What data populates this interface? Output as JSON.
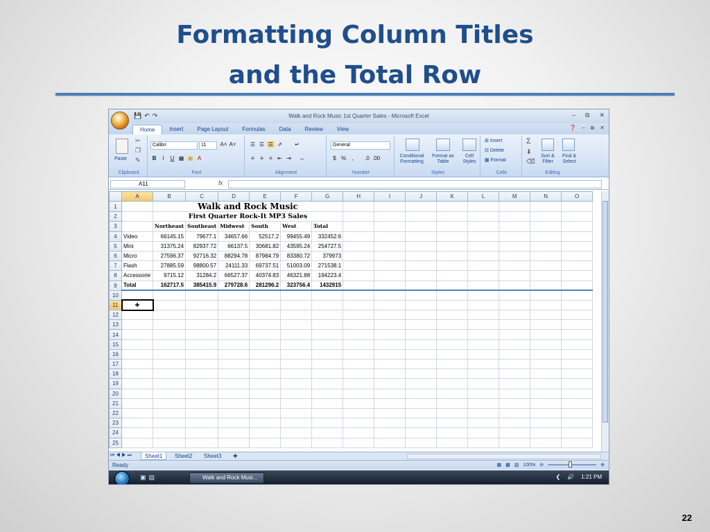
{
  "slide": {
    "title_line1": "Formatting Column Titles",
    "title_line2": "and the Total Row",
    "page_number": "22"
  },
  "excel": {
    "window_title": "Walk and Rock Music 1st Quarter Sales - Microsoft Excel",
    "tabs": [
      "Home",
      "Insert",
      "Page Layout",
      "Formulas",
      "Data",
      "Review",
      "View"
    ],
    "ribbon": {
      "paste_label": "Paste",
      "font_name": "Calibri",
      "font_size": "11",
      "number_format": "General",
      "conditional_formatting": "Conditional Formatting",
      "format_as_table": "Format as Table",
      "cell_styles": "Cell Styles",
      "insert": "Insert",
      "delete": "Delete",
      "format": "Format",
      "sort_filter": "Sort & Filter",
      "find_select": "Find & Select",
      "groups": [
        "Clipboard",
        "Font",
        "Alignment",
        "Number",
        "Styles",
        "Cells",
        "Editing"
      ]
    },
    "name_box": "A11",
    "fx_label": "fx",
    "columns": [
      "A",
      "B",
      "C",
      "D",
      "E",
      "F",
      "G",
      "H",
      "I",
      "J",
      "K",
      "L",
      "M",
      "N",
      "O"
    ],
    "sheet_title": "Walk and Rock Music",
    "sheet_subtitle": "First Quarter Rock-It MP3 Sales",
    "headers": [
      "Northeast",
      "Southeast",
      "Midwest",
      "South",
      "West",
      "Total"
    ],
    "rows": [
      {
        "label": "Video",
        "values": [
          "66145.15",
          "79677.1",
          "34657.66",
          "52517.2",
          "99455.49",
          "332452.6"
        ]
      },
      {
        "label": "Mini",
        "values": [
          "31375.24",
          "82937.72",
          "66137.5",
          "30681.82",
          "43595.24",
          "254727.5"
        ]
      },
      {
        "label": "Micro",
        "values": [
          "27596.37",
          "92716.32",
          "88294.78",
          "87984.79",
          "83380.72",
          "379973"
        ]
      },
      {
        "label": "Flash",
        "values": [
          "27885.59",
          "98800.57",
          "24111.33",
          "69737.51",
          "51003.09",
          "271538.1"
        ]
      },
      {
        "label": "Accessorie",
        "values": [
          "9715.12",
          "31284.2",
          "66527.37",
          "40374.83",
          "46321.88",
          "194223.4"
        ]
      }
    ],
    "total_row": {
      "label": "Total",
      "values": [
        "162717.5",
        "385415.9",
        "279728.6",
        "281296.2",
        "323756.4",
        "1432915"
      ]
    },
    "sheet_tabs": [
      "Sheet1",
      "Sheet2",
      "Sheet3"
    ],
    "status": "Ready",
    "zoom": "100%",
    "taskbar_item": "Walk and Rock Musi...",
    "clock": "1:21 PM"
  }
}
